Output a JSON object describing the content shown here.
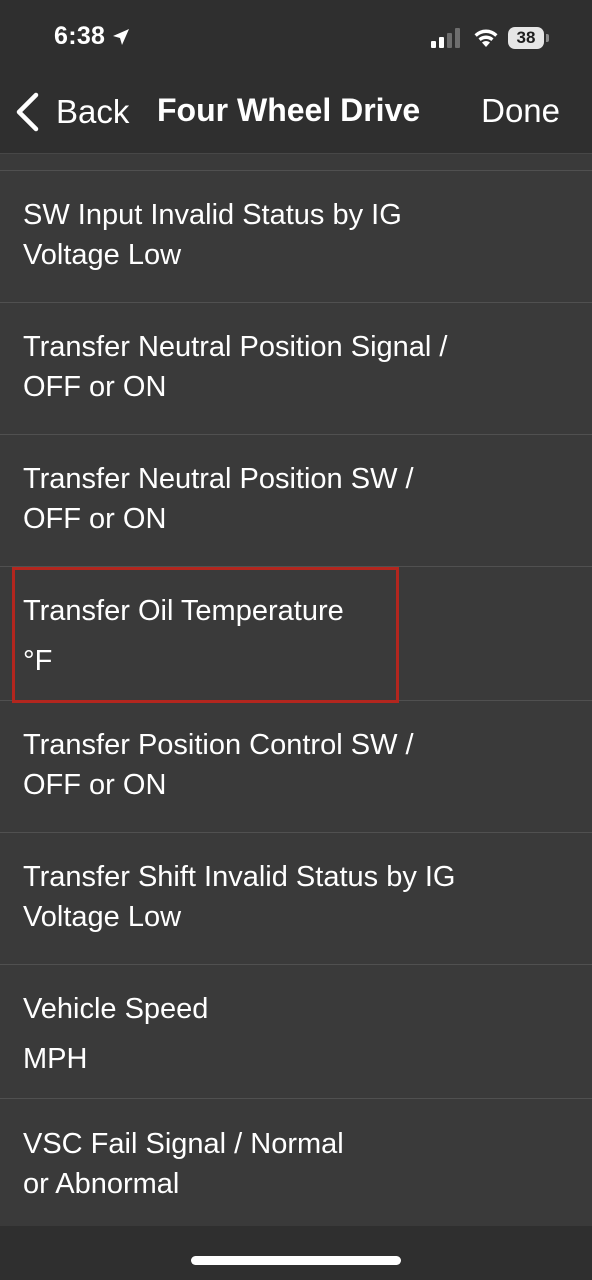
{
  "status_bar": {
    "time": "6:38",
    "battery_level": "38"
  },
  "nav": {
    "back_label": "Back",
    "title": "Four Wheel Drive",
    "done_label": "Done"
  },
  "rows": [
    {
      "line1": "SW Input Invalid Status by IG",
      "line2": "Voltage Low"
    },
    {
      "line1": "Transfer Neutral Position Signal /",
      "line2": "OFF or ON"
    },
    {
      "line1": "Transfer Neutral Position SW /",
      "line2": "OFF or ON"
    },
    {
      "line1": "Transfer Oil Temperature",
      "line2": "°F",
      "highlighted": true
    },
    {
      "line1": "Transfer Position Control SW /",
      "line2": "OFF or ON"
    },
    {
      "line1": "Transfer Shift Invalid Status by IG",
      "line2": "Voltage Low"
    },
    {
      "line1": "Vehicle Speed",
      "line2": "MPH"
    },
    {
      "line1": "VSC Fail Signal / Normal",
      "line2": "or Abnormal"
    }
  ],
  "colors": {
    "background": "#2f2f2f",
    "list_background": "#3a3a3a",
    "separator": "#505050",
    "highlight_border": "#b3261e",
    "text": "#ffffff"
  }
}
